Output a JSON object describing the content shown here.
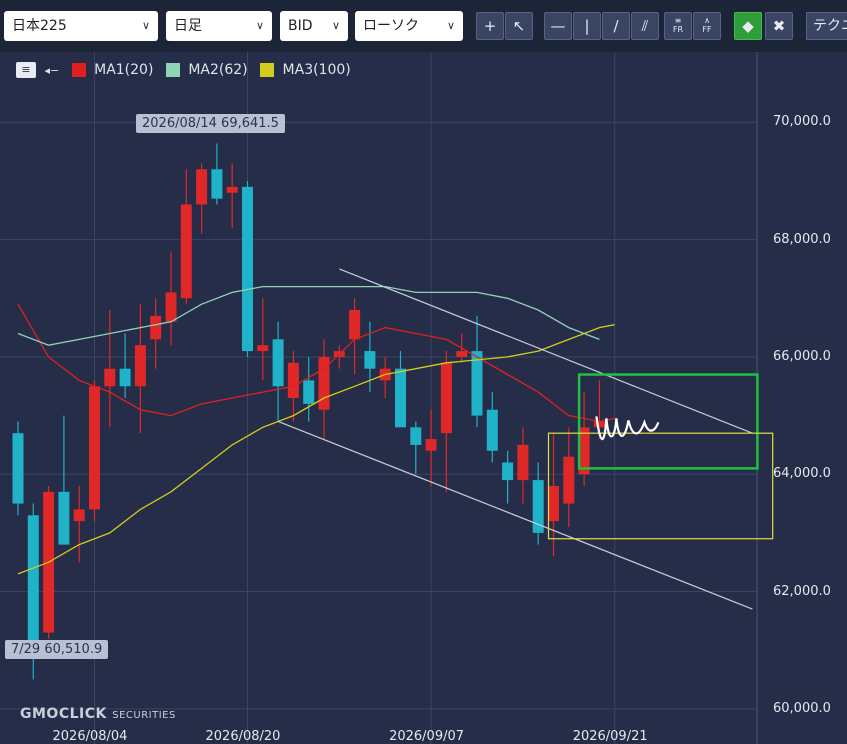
{
  "toolbar": {
    "symbol": "日本225",
    "period": "日足",
    "price_type": "BID",
    "chart_type": "ローソク",
    "technical_tab": "テクニカル",
    "tools": [
      "crosshair-icon",
      "cursor-icon",
      "horizontal-line-icon",
      "vertical-line-icon",
      "trend-line-icon",
      "parallel-lines-icon",
      "fibonacci-retracement-icon",
      "fibonacci-fan-icon",
      "eraser-icon",
      "clear-all-icon"
    ],
    "tool_labels": {
      "fr": "FR",
      "ff": "FF"
    },
    "active_color": "#2f9e3a"
  },
  "legend": [
    {
      "name": "MA1(20)",
      "color": "#e02020"
    },
    {
      "name": "MA2(62)",
      "color": "#8fd4b4"
    },
    {
      "name": "MA3(100)",
      "color": "#d4cc1a"
    }
  ],
  "annotations": {
    "high_tag": "2026/08/14 69,641.5",
    "low_tag": "7/29 60,510.9"
  },
  "brand": {
    "name": "GMOCLICK",
    "suffix": "SECURITIES"
  },
  "chart_data": {
    "type": "candlestick",
    "ylim": [
      59400,
      71200
    ],
    "y_ticks": [
      "70,000.0",
      "68,000.0",
      "66,000.0",
      "64,000.0",
      "62,000.0",
      "60,000.0"
    ],
    "y_tick_values": [
      70000,
      68000,
      66000,
      64000,
      62000,
      60000
    ],
    "x_ticks": [
      "2026/08/04",
      "2026/08/20",
      "2026/09/07",
      "2026/09/21"
    ],
    "x_tick_index": [
      5,
      15,
      27,
      39
    ],
    "up_color": "#e02828",
    "down_color": "#1fb2c8",
    "candles": [
      {
        "o": 64700,
        "h": 64900,
        "l": 63300,
        "c": 63500
      },
      {
        "o": 63300,
        "h": 63500,
        "l": 60500,
        "c": 61000
      },
      {
        "o": 61300,
        "h": 63800,
        "l": 61200,
        "c": 63700
      },
      {
        "o": 63700,
        "h": 65000,
        "l": 62800,
        "c": 62800
      },
      {
        "o": 63200,
        "h": 63800,
        "l": 62500,
        "c": 63400
      },
      {
        "o": 63400,
        "h": 65600,
        "l": 63200,
        "c": 65500
      },
      {
        "o": 65500,
        "h": 66800,
        "l": 64800,
        "c": 65800
      },
      {
        "o": 65800,
        "h": 66400,
        "l": 65300,
        "c": 65500
      },
      {
        "o": 65500,
        "h": 66900,
        "l": 64700,
        "c": 66200
      },
      {
        "o": 66300,
        "h": 67000,
        "l": 65800,
        "c": 66700
      },
      {
        "o": 66600,
        "h": 67800,
        "l": 66200,
        "c": 67100
      },
      {
        "o": 67000,
        "h": 69200,
        "l": 66900,
        "c": 68600
      },
      {
        "o": 68600,
        "h": 69300,
        "l": 68100,
        "c": 69200
      },
      {
        "o": 69200,
        "h": 69641,
        "l": 68600,
        "c": 68700
      },
      {
        "o": 68800,
        "h": 69300,
        "l": 68200,
        "c": 68900
      },
      {
        "o": 68900,
        "h": 69000,
        "l": 66000,
        "c": 66100
      },
      {
        "o": 66100,
        "h": 67000,
        "l": 65600,
        "c": 66200
      },
      {
        "o": 66300,
        "h": 66600,
        "l": 64900,
        "c": 65500
      },
      {
        "o": 65300,
        "h": 66100,
        "l": 64900,
        "c": 65900
      },
      {
        "o": 65600,
        "h": 66000,
        "l": 64900,
        "c": 65200
      },
      {
        "o": 65100,
        "h": 66300,
        "l": 64600,
        "c": 66000
      },
      {
        "o": 66000,
        "h": 66200,
        "l": 65800,
        "c": 66100
      },
      {
        "o": 66300,
        "h": 67000,
        "l": 65700,
        "c": 66800
      },
      {
        "o": 66100,
        "h": 66600,
        "l": 65400,
        "c": 65800
      },
      {
        "o": 65600,
        "h": 66000,
        "l": 65300,
        "c": 65800
      },
      {
        "o": 65800,
        "h": 66100,
        "l": 64800,
        "c": 64800
      },
      {
        "o": 64800,
        "h": 64900,
        "l": 64000,
        "c": 64500
      },
      {
        "o": 64400,
        "h": 65100,
        "l": 63800,
        "c": 64600
      },
      {
        "o": 64700,
        "h": 66100,
        "l": 63700,
        "c": 65900
      },
      {
        "o": 66000,
        "h": 66400,
        "l": 65900,
        "c": 66100
      },
      {
        "o": 66100,
        "h": 66700,
        "l": 64800,
        "c": 65000
      },
      {
        "o": 65100,
        "h": 65400,
        "l": 64200,
        "c": 64400
      },
      {
        "o": 64200,
        "h": 64400,
        "l": 63500,
        "c": 63900
      },
      {
        "o": 63900,
        "h": 64800,
        "l": 63500,
        "c": 64500
      },
      {
        "o": 63900,
        "h": 64200,
        "l": 62800,
        "c": 63000
      },
      {
        "o": 63200,
        "h": 64700,
        "l": 62600,
        "c": 63800
      },
      {
        "o": 63500,
        "h": 64800,
        "l": 63100,
        "c": 64300
      },
      {
        "o": 64000,
        "h": 65400,
        "l": 63800,
        "c": 64800
      },
      {
        "o": 64800,
        "h": 65600,
        "l": 64600,
        "c": 64900
      }
    ],
    "series": [
      {
        "name": "MA1(20)",
        "color": "#e02020",
        "values": [
          [
            0,
            66900
          ],
          [
            2,
            66000
          ],
          [
            4,
            65600
          ],
          [
            6,
            65400
          ],
          [
            8,
            65100
          ],
          [
            10,
            65000
          ],
          [
            12,
            65200
          ],
          [
            14,
            65300
          ],
          [
            16,
            65400
          ],
          [
            18,
            65500
          ],
          [
            20,
            65800
          ],
          [
            22,
            66300
          ],
          [
            24,
            66500
          ],
          [
            26,
            66400
          ],
          [
            28,
            66300
          ],
          [
            30,
            66000
          ],
          [
            32,
            65700
          ],
          [
            34,
            65400
          ],
          [
            36,
            65000
          ],
          [
            38,
            64900
          ],
          [
            39,
            64950
          ]
        ]
      },
      {
        "name": "MA2(62)",
        "color": "#8fd4b4",
        "values": [
          [
            0,
            66400
          ],
          [
            2,
            66200
          ],
          [
            4,
            66300
          ],
          [
            6,
            66400
          ],
          [
            8,
            66500
          ],
          [
            10,
            66600
          ],
          [
            12,
            66900
          ],
          [
            14,
            67100
          ],
          [
            16,
            67200
          ],
          [
            18,
            67200
          ],
          [
            20,
            67200
          ],
          [
            22,
            67200
          ],
          [
            24,
            67200
          ],
          [
            26,
            67100
          ],
          [
            28,
            67100
          ],
          [
            30,
            67100
          ],
          [
            32,
            67000
          ],
          [
            34,
            66800
          ],
          [
            36,
            66500
          ],
          [
            38,
            66300
          ]
        ]
      },
      {
        "name": "MA3(100)",
        "color": "#d4cc1a",
        "values": [
          [
            0,
            62300
          ],
          [
            2,
            62500
          ],
          [
            4,
            62800
          ],
          [
            6,
            63000
          ],
          [
            8,
            63400
          ],
          [
            10,
            63700
          ],
          [
            12,
            64100
          ],
          [
            14,
            64500
          ],
          [
            16,
            64800
          ],
          [
            18,
            65000
          ],
          [
            20,
            65300
          ],
          [
            22,
            65500
          ],
          [
            24,
            65700
          ],
          [
            26,
            65800
          ],
          [
            28,
            65900
          ],
          [
            30,
            65950
          ],
          [
            32,
            66000
          ],
          [
            34,
            66100
          ],
          [
            36,
            66300
          ],
          [
            38,
            66500
          ],
          [
            39,
            66550
          ]
        ]
      }
    ],
    "trendlines": [
      {
        "from": [
          21,
          67500
        ],
        "to": [
          48,
          64700
        ],
        "color": "#c8ccd8"
      },
      {
        "from": [
          17,
          64900
        ],
        "to": [
          48,
          61700
        ],
        "color": "#c8ccd8"
      }
    ],
    "boxes": [
      {
        "from": [
          37,
          64100
        ],
        "to": [
          48,
          65700
        ],
        "color": "#22c040"
      },
      {
        "from": [
          35,
          62900
        ],
        "to": [
          49,
          64700
        ],
        "color": "#e2e040"
      }
    ]
  }
}
